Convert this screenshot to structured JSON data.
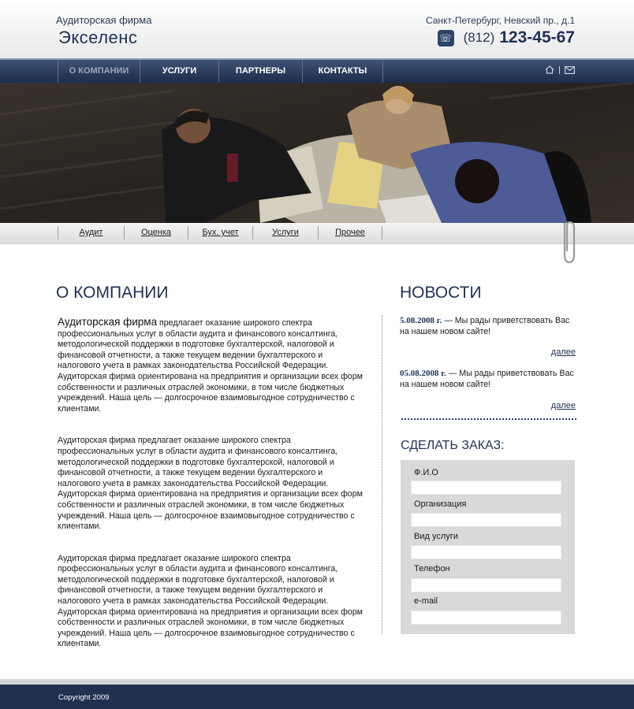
{
  "header": {
    "tagline": "Аудиторская фирма",
    "brand": "Экселенс",
    "address": "Санкт-Петербург, Невский пр., д.1",
    "phone_code": "(812)",
    "phone_number": "123-45-67"
  },
  "topnav": {
    "items": [
      {
        "label": "О КОМПАНИИ",
        "active": true
      },
      {
        "label": "УСЛУГИ",
        "active": false
      },
      {
        "label": "ПАРТНЕРЫ",
        "active": false
      },
      {
        "label": "КОНТАКТЫ",
        "active": false
      }
    ],
    "icons": [
      "home-icon",
      "mail-icon"
    ]
  },
  "banner": {
    "icon": "business-meeting-photo"
  },
  "subnav": {
    "items": [
      {
        "label": "Аудит"
      },
      {
        "label": "Оценка"
      },
      {
        "label": "Бух. учет"
      },
      {
        "label": "Услуги"
      },
      {
        "label": "Прочее"
      }
    ]
  },
  "about": {
    "title": "О КОМПАНИИ",
    "lead": "Аудиторская фирма",
    "p1_rest": " предлагает оказание широкого спектра профессиональных услуг в области аудита и финансового консалтинга, методологической поддержки в подготовке бухгалтерской, налоговой и финансовой отчетности, а также текущем ведении бухгалтерского и налогового учета в рамках законодательства Российской Федерации. Аудиторская фирма ориентирована на предприятия и организации всех форм собственности и различных отраслей экономики, в том числе бюджетных учреждений. Наша цель — долгосрочное взаимовыгодное сотрудничество с клиентами.",
    "p2": "Аудиторская фирма предлагает оказание широкого спектра профессиональных услуг в области аудита и финансового консалтинга, методологической поддержки в подготовке бухгалтерской, налоговой и финансовой отчетности, а также текущем ведении бухгалтерского и налогового учета в рамках законодательства Российской Федерации. Аудиторская фирма ориентирована на предприятия и организации всех форм собственности и различных отраслей экономики, в том числе бюджетных учреждений. Наша цель — долгосрочное взаимовыгодное сотрудничество с клиентами.",
    "p3": "Аудиторская фирма предлагает оказание широкого спектра профессиональных услуг в области аудита и финансового консалтинга, методологической поддержки в подготовке бухгалтерской, налоговой и финансовой отчетности, а также текущем ведении бухгалтерского и налогового учета в рамках законодательства Российской Федерации. Аудиторская фирма ориентирована на предприятия и организации всех форм собственности и различных отраслей экономики, в том числе бюджетных учреждений. Наша цель — долгосрочное взаимовыгодное сотрудничество с клиентами."
  },
  "news": {
    "title": "НОВОСТИ",
    "items": [
      {
        "date": "5.08.2008 г.",
        "text": " — Мы рады приветствовать Вас на нашем новом сайте!",
        "more": "далее"
      },
      {
        "date": "05.08.2008 г.",
        "text": " — Мы рады приветствовать Вас на нашем новом сайте!",
        "more": "далее"
      }
    ]
  },
  "order": {
    "title": "СДЕЛАТЬ ЗАКАЗ:",
    "fields": [
      {
        "label": "Ф.И.О",
        "value": ""
      },
      {
        "label": "Организация",
        "value": ""
      },
      {
        "label": "Вид услуги",
        "value": ""
      },
      {
        "label": "Телефон",
        "value": ""
      },
      {
        "label": "e-mail",
        "value": ""
      }
    ]
  },
  "footer": {
    "copyright": "Copyright 2009"
  },
  "colors": {
    "navy": "#1f3157",
    "nav_bg": "#2a3b5d",
    "form_bg": "#d9d9d9"
  }
}
